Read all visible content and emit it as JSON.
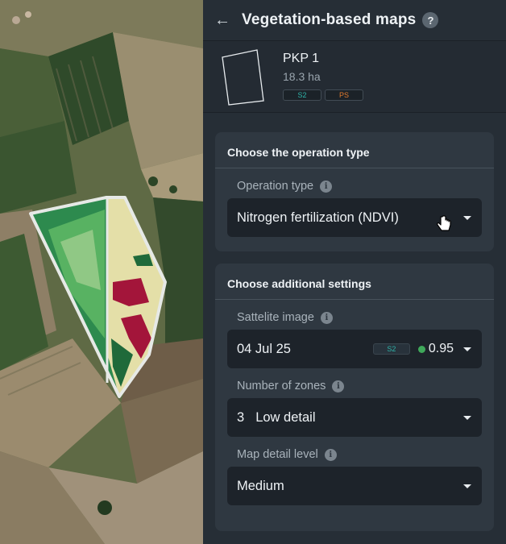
{
  "header": {
    "title": "Vegetation-based maps",
    "help_icon": "?"
  },
  "field": {
    "name": "PKP 1",
    "area": "18.3 ha",
    "badges": [
      "S2",
      "PS"
    ]
  },
  "operation_section": {
    "heading": "Choose the operation type",
    "operation_type": {
      "label": "Operation type",
      "value": "Nitrogen fertilization (NDVI)"
    }
  },
  "settings_section": {
    "heading": "Choose additional settings",
    "satellite_image": {
      "label": "Sattelite image",
      "date": "04 Jul 25",
      "source": "S2",
      "score": "0.95"
    },
    "zones": {
      "label": "Number of zones",
      "number": "3",
      "detail": "Low detail"
    },
    "detail_level": {
      "label": "Map detail level",
      "value": "Medium"
    }
  },
  "colors": {
    "panel": "#262e36",
    "section": "#2f3841",
    "select": "#1d232a",
    "accent_s2": "#2fb3a8",
    "accent_ps": "#e07a2e",
    "quality_dot": "#3fa85a"
  }
}
